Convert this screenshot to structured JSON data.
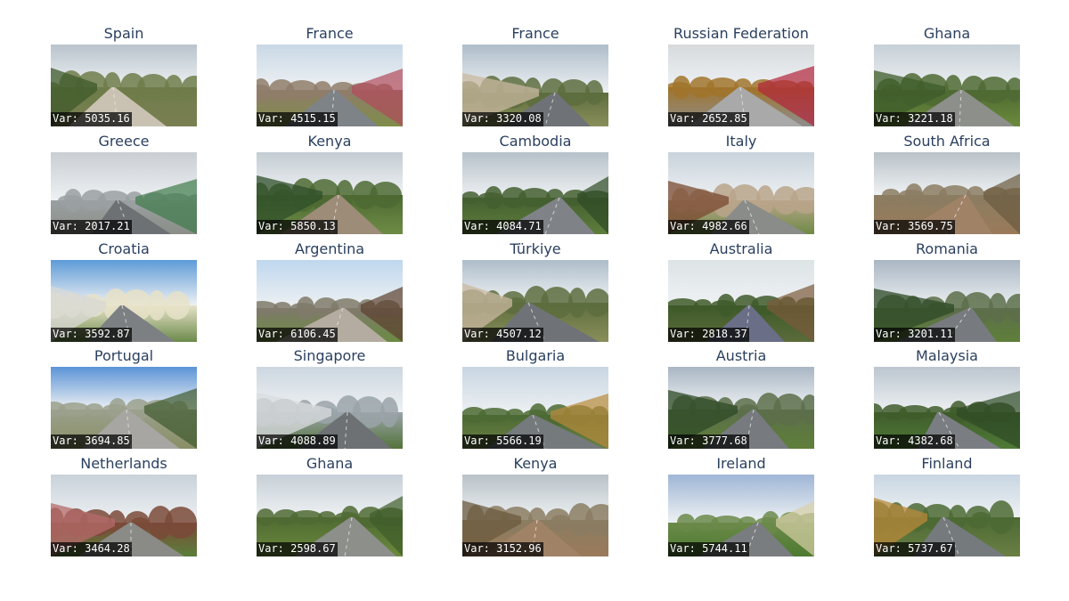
{
  "var_prefix": "Var: ",
  "images": [
    {
      "country": "Spain",
      "var": "5035.16",
      "scene": "rural-lane"
    },
    {
      "country": "France",
      "var": "4515.15",
      "scene": "town-street-trees"
    },
    {
      "country": "France",
      "var": "3320.08",
      "scene": "country-road"
    },
    {
      "country": "Russian Federation",
      "var": "2652.85",
      "scene": "sidewalk-autumn"
    },
    {
      "country": "Ghana",
      "var": "3221.18",
      "scene": "rural-road"
    },
    {
      "country": "Greece",
      "var": "2017.21",
      "scene": "industrial-road"
    },
    {
      "country": "Kenya",
      "var": "5850.13",
      "scene": "dirt-road"
    },
    {
      "country": "Cambodia",
      "var": "4084.71",
      "scene": "palm-road"
    },
    {
      "country": "Italy",
      "var": "4982.66",
      "scene": "villa-road"
    },
    {
      "country": "South Africa",
      "var": "3569.75",
      "scene": "open-field"
    },
    {
      "country": "Croatia",
      "var": "3592.87",
      "scene": "street-buildings"
    },
    {
      "country": "Argentina",
      "var": "6106.45",
      "scene": "bright-street"
    },
    {
      "country": "Türkiye",
      "var": "4507.12",
      "scene": "country-road"
    },
    {
      "country": "Australia",
      "var": "2818.37",
      "scene": "forest-path"
    },
    {
      "country": "Romania",
      "var": "3201.11",
      "scene": "mountain-road"
    },
    {
      "country": "Portugal",
      "var": "3694.85",
      "scene": "blue-sky-street"
    },
    {
      "country": "Singapore",
      "var": "4088.89",
      "scene": "city-street"
    },
    {
      "country": "Bulgaria",
      "var": "5566.19",
      "scene": "tree-lined-road"
    },
    {
      "country": "Austria",
      "var": "3777.68",
      "scene": "mountain-road"
    },
    {
      "country": "Malaysia",
      "var": "4382.68",
      "scene": "grass-road"
    },
    {
      "country": "Netherlands",
      "var": "3464.28",
      "scene": "brick-street"
    },
    {
      "country": "Ghana",
      "var": "2598.67",
      "scene": "rural-road"
    },
    {
      "country": "Kenya",
      "var": "3152.96",
      "scene": "open-field"
    },
    {
      "country": "Ireland",
      "var": "5744.11",
      "scene": "hedge-road"
    },
    {
      "country": "Finland",
      "var": "5737.67",
      "scene": "tree-lined-road"
    }
  ]
}
